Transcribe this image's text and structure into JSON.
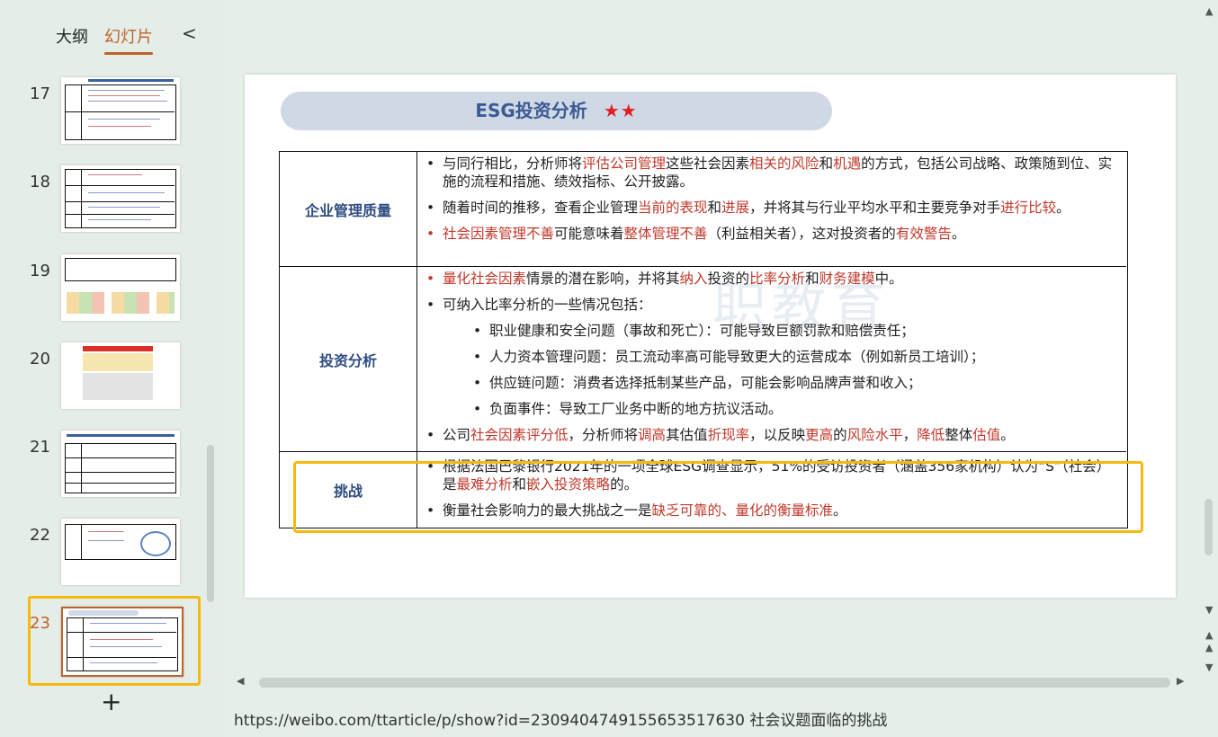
{
  "sidebar": {
    "tab_outline": "大纲",
    "tab_slides": "幻灯片",
    "collapse": "<",
    "add": "+",
    "slides": [
      {
        "num": "17"
      },
      {
        "num": "18"
      },
      {
        "num": "19"
      },
      {
        "num": "20"
      },
      {
        "num": "21"
      },
      {
        "num": "22"
      },
      {
        "num": "23"
      }
    ]
  },
  "slide": {
    "title": "ESG投资分析",
    "stars": "★★",
    "watermark": "职教育",
    "rows": [
      {
        "category": "企业管理质量",
        "bullets": [
          {
            "parts": [
              "与同行相比，分析师将",
              "评估公司管理",
              "这些社会因素",
              "相关的风险",
              "和",
              "机遇",
              "的方式，包括公司战略、政策随到位、实施的流程和措施、绩效指标、公开披露。"
            ]
          },
          {
            "parts": [
              "随着时间的推移，查看企业管理",
              "当前的表现",
              "和",
              "进展",
              "，并将其与行业平均水平和主要竞争对手",
              "进行比较",
              "。"
            ]
          },
          {
            "parts": [
              "社会因素管理不善",
              "可能意味着",
              "整体管理不善",
              "（利益相关者），这对投资者的",
              "有效警告",
              "。"
            ]
          }
        ]
      },
      {
        "category": "投资分析",
        "bullets": [
          {
            "parts": [
              "量化社会因素",
              "情景的潜在影响，并将其",
              "纳入",
              "投资的",
              "比率分析",
              "和",
              "财务建模",
              "中。"
            ]
          },
          {
            "parts": [
              "可纳入比率分析的一些情况包括："
            ]
          },
          {
            "parts": [
              "公司",
              "社会因素评分低",
              "，分析师将",
              "调高",
              "其估值",
              "折现率",
              "，以反映",
              "更高",
              "的",
              "风险水平",
              "，",
              "降低",
              "整体",
              "估值",
              "。"
            ]
          }
        ],
        "sub_bullets": [
          "职业健康和安全问题（事故和死亡）：可能导致巨额罚款和赔偿责任；",
          "人力资本管理问题：员工流动率高可能导致更大的运营成本（例如新员工培训）；",
          "供应链问题：消费者选择抵制某些产品，可能会影响品牌声誉和收入；",
          "负面事件：导致工厂业务中断的地方抗议活动。"
        ]
      },
      {
        "category": "挑战",
        "bullets": [
          {
            "parts": [
              "根据法国巴黎银行2021年的一项全球ESG调查显示，51%的受访投资者（涵盖356家机构）认为“S”（社会）是",
              "最难分析",
              "和",
              "嵌入投资策略",
              "的。"
            ]
          },
          {
            "parts": [
              "衡量社会影响力的最大挑战之一是",
              "缺乏可靠的、量化的衡量标准",
              "。"
            ]
          }
        ]
      }
    ]
  },
  "footer": {
    "text": "https://weibo.com/ttarticle/p/show?id=2309404749155653517630 社会议题面临的挑战"
  },
  "colors": {
    "accent": "#c0622a",
    "highlight": "#c0392b",
    "title_blue": "#3b5a93",
    "callout": "#f6b90f"
  }
}
